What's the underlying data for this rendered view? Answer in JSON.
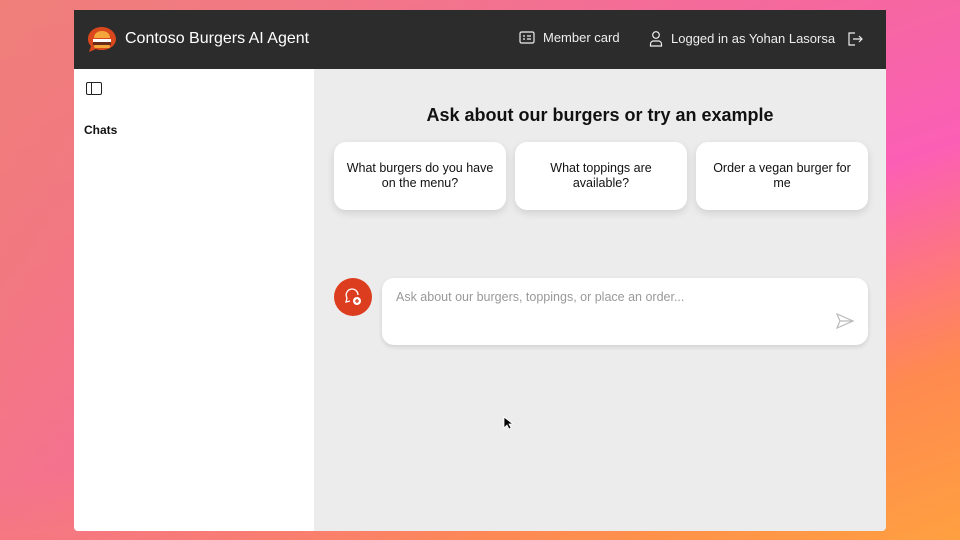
{
  "header": {
    "title": "Contoso Burgers AI Agent",
    "member_card": "Member card",
    "logged_in": "Logged in as Yohan Lasorsa"
  },
  "sidebar": {
    "chats_label": "Chats"
  },
  "main": {
    "heading": "Ask about our burgers or try an example",
    "examples": [
      {
        "label": "What burgers do you have on the menu?"
      },
      {
        "label": "What toppings are available?"
      },
      {
        "label": "Order a vegan burger for me"
      }
    ],
    "input_placeholder": "Ask about our burgers, toppings, or place an order..."
  },
  "colors": {
    "header_bg": "#2c2c2c",
    "accent": "#dc3d1e",
    "main_bg": "#ececec"
  }
}
